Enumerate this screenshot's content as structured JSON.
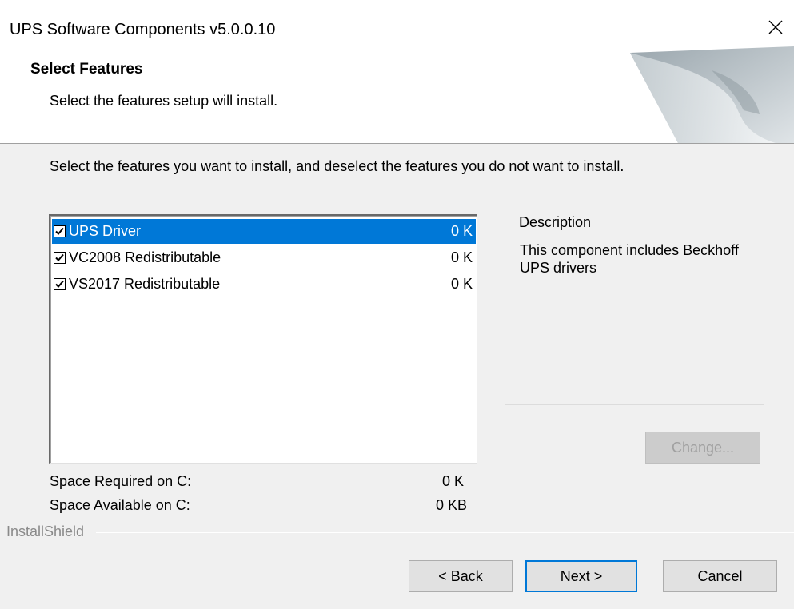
{
  "window": {
    "title": "UPS Software Components v5.0.0.10"
  },
  "header": {
    "title": "Select Features",
    "subtitle": "Select the features setup will install."
  },
  "instruction": "Select the features you want to install, and deselect the features you do not want to install.",
  "features": [
    {
      "label": "UPS Driver",
      "size": "0 K",
      "checked": true,
      "selected": true
    },
    {
      "label": "VC2008 Redistributable",
      "size": "0 K",
      "checked": true,
      "selected": false
    },
    {
      "label": "VS2017 Redistributable",
      "size": "0 K",
      "checked": true,
      "selected": false
    }
  ],
  "space": {
    "required_label": "Space Required on  C:",
    "required_value": "0 K",
    "available_label": "Space Available on  C:",
    "available_value": "0 KB"
  },
  "description": {
    "legend": "Description",
    "text": "This component includes Beckhoff UPS drivers"
  },
  "buttons": {
    "change": "Change...",
    "back": "< Back",
    "next": "Next >",
    "cancel": "Cancel"
  },
  "brand": "InstallShield",
  "colors": {
    "selection": "#0078d7",
    "window_bg": "#f0f0f0"
  }
}
